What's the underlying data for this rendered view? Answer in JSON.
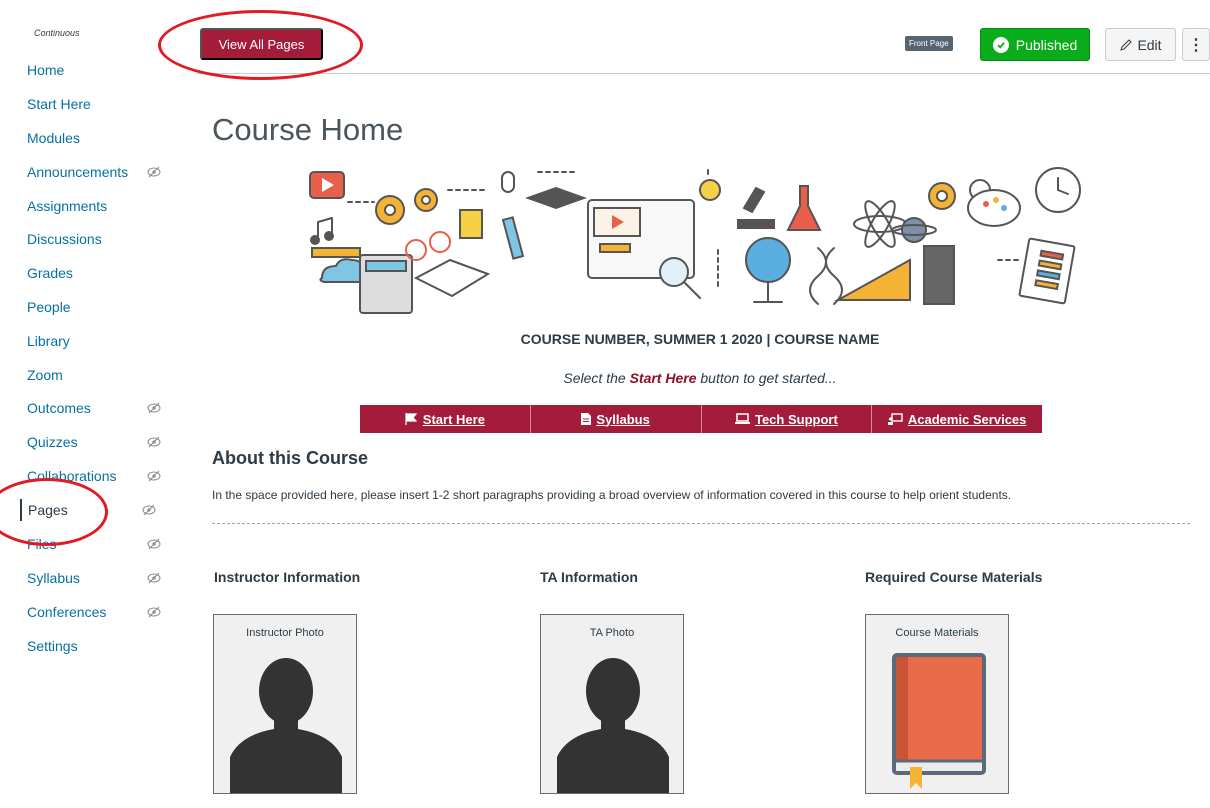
{
  "sidebar": {
    "caption": "Continuous",
    "items": [
      {
        "label": "Home",
        "hidden": false
      },
      {
        "label": "Start Here",
        "hidden": false
      },
      {
        "label": "Modules",
        "hidden": false
      },
      {
        "label": "Announcements",
        "hidden": true
      },
      {
        "label": "Assignments",
        "hidden": false
      },
      {
        "label": "Discussions",
        "hidden": false
      },
      {
        "label": "Grades",
        "hidden": false
      },
      {
        "label": "People",
        "hidden": false
      },
      {
        "label": "Library",
        "hidden": false
      },
      {
        "label": "Zoom",
        "hidden": false
      },
      {
        "label": "Outcomes",
        "hidden": true
      },
      {
        "label": "Quizzes",
        "hidden": true
      },
      {
        "label": "Collaborations",
        "hidden": true
      },
      {
        "label": "Pages",
        "hidden": true,
        "active": true
      },
      {
        "label": "Files",
        "hidden": true
      },
      {
        "label": "Syllabus",
        "hidden": true
      },
      {
        "label": "Conferences",
        "hidden": true
      },
      {
        "label": "Settings",
        "hidden": false
      }
    ]
  },
  "header": {
    "view_all_label": "View All Pages",
    "front_page_badge": "Front Page",
    "published_label": "Published",
    "edit_label": "Edit",
    "more_label": "⋮"
  },
  "page": {
    "title": "Course Home",
    "course_line": "COURSE NUMBER, SUMMER 1 2020 | COURSE NAME",
    "instruction_prefix": "Select the ",
    "instruction_highlight": "Start Here",
    "instruction_suffix": " button to get started...",
    "nav_buttons": [
      {
        "label": "Start Here",
        "icon": "flag-icon"
      },
      {
        "label": "Syllabus",
        "icon": "document-icon"
      },
      {
        "label": "Tech Support",
        "icon": "laptop-icon"
      },
      {
        "label": "Academic Services",
        "icon": "presentation-icon"
      }
    ],
    "about_heading": "About this Course",
    "about_text": "In the space provided here, please insert 1-2 short paragraphs providing a broad overview of information covered in this course to help orient students.",
    "columns": [
      {
        "heading": "Instructor Information",
        "card_label": "Instructor Photo"
      },
      {
        "heading": "TA Information",
        "card_label": "TA Photo"
      },
      {
        "heading": "Required Course Materials",
        "card_label": "Course Materials"
      }
    ]
  },
  "colors": {
    "link": "#0770a3",
    "brand": "#a31d3a",
    "published": "#0bac1c",
    "annotation": "#e01b24"
  }
}
